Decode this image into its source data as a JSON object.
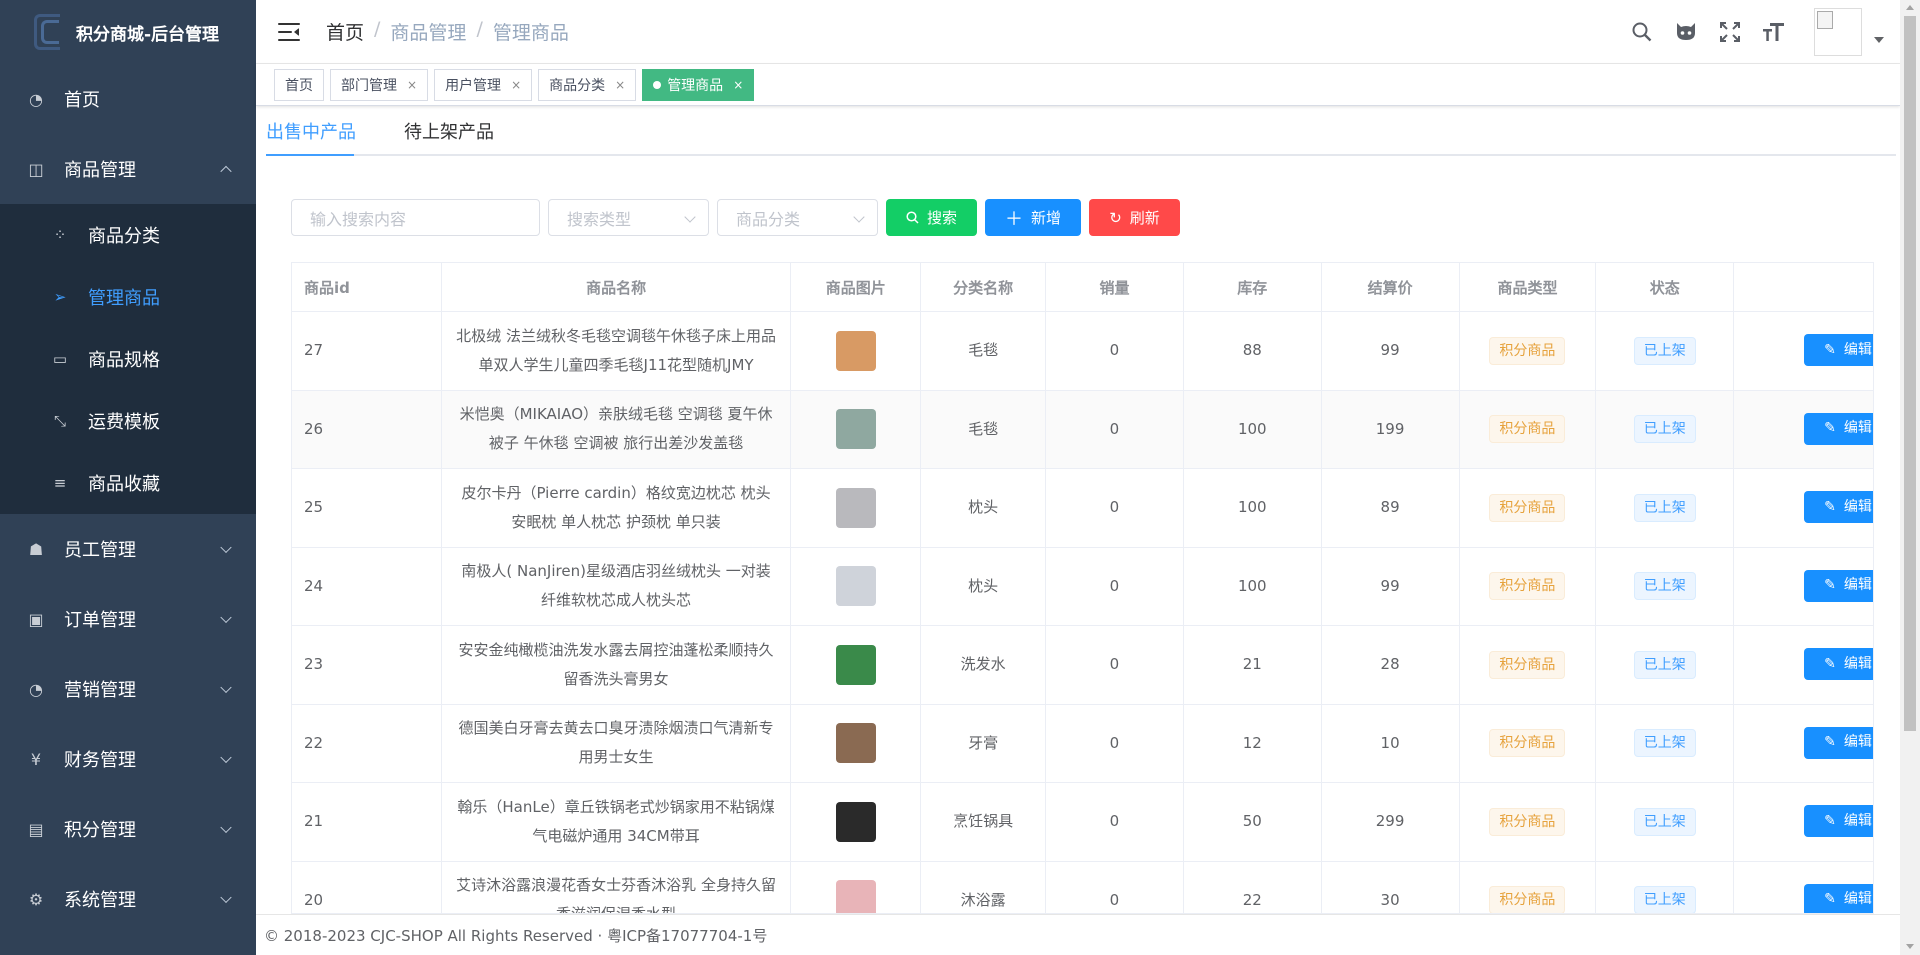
{
  "app": {
    "title": "积分商城-后台管理"
  },
  "sidebar": {
    "items": [
      {
        "label": "首页",
        "icon": "dashboard-icon"
      },
      {
        "label": "商品管理",
        "icon": "shopping-icon",
        "expanded": true,
        "children": [
          {
            "label": "商品分类",
            "icon": "category-icon"
          },
          {
            "label": "管理商品",
            "icon": "send-icon",
            "active": true
          },
          {
            "label": "商品规格",
            "icon": "monitor-icon"
          },
          {
            "label": "运费模板",
            "icon": "shrink-icon"
          },
          {
            "label": "商品收藏",
            "icon": "list-icon"
          }
        ]
      },
      {
        "label": "员工管理",
        "icon": "peoples-icon"
      },
      {
        "label": "订单管理",
        "icon": "lock-icon"
      },
      {
        "label": "营销管理",
        "icon": "dashboard-icon"
      },
      {
        "label": "财务管理",
        "icon": "money-icon"
      },
      {
        "label": "积分管理",
        "icon": "date-icon"
      },
      {
        "label": "系统管理",
        "icon": "gear-icon"
      }
    ]
  },
  "breadcrumb": [
    "首页",
    "商品管理",
    "管理商品"
  ],
  "tags": [
    {
      "label": "首页",
      "closable": false
    },
    {
      "label": "部门管理",
      "closable": true
    },
    {
      "label": "用户管理",
      "closable": true
    },
    {
      "label": "商品分类",
      "closable": true
    },
    {
      "label": "管理商品",
      "closable": true,
      "active": true
    }
  ],
  "tabs": [
    "出售中产品",
    "待上架产品"
  ],
  "toolbar": {
    "search_placeholder": "输入搜索内容",
    "type_placeholder": "搜索类型",
    "category_placeholder": "商品分类",
    "search_label": "搜索",
    "add_label": "新增",
    "refresh_label": "刷新",
    "colors": {
      "search": "#13ce66",
      "add": "#1890ff",
      "refresh": "#ff4949"
    }
  },
  "table": {
    "headers": [
      "商品id",
      "商品名称",
      "商品图片",
      "分类名称",
      "销量",
      "库存",
      "结算价",
      "商品类型",
      "状态"
    ],
    "edit_label": "编辑",
    "rows": [
      {
        "id": "27",
        "name": "北极绒 法兰绒秋冬毛毯空调毯午休毯子床上用品单双人学生儿童四季毛毯J11花型随机JMY",
        "category": "毛毯",
        "sales": "0",
        "stock": "88",
        "price": "99",
        "type": "积分商品",
        "status": "已上架",
        "thumb": "#d89a64"
      },
      {
        "id": "26",
        "name": "米恺奥（MIKAIAO）亲肤绒毛毯 空调毯 夏午休被子 午休毯 空调被 旅行出差沙发盖毯",
        "category": "毛毯",
        "sales": "0",
        "stock": "100",
        "price": "199",
        "type": "积分商品",
        "status": "已上架",
        "thumb": "#8fa8a0"
      },
      {
        "id": "25",
        "name": "皮尔卡丹（Pierre cardin）格纹宽边枕芯 枕头 安眠枕 单人枕芯 护颈枕 单只装",
        "category": "枕头",
        "sales": "0",
        "stock": "100",
        "price": "89",
        "type": "积分商品",
        "status": "已上架",
        "thumb": "#b9b9bd"
      },
      {
        "id": "24",
        "name": "南极人( NanJiren)星级酒店羽丝绒枕头 一对装 纤维软枕芯成人枕头芯",
        "category": "枕头",
        "sales": "0",
        "stock": "100",
        "price": "99",
        "type": "积分商品",
        "status": "已上架",
        "thumb": "#cfd3da"
      },
      {
        "id": "23",
        "name": "安安金纯橄榄油洗发水露去屑控油蓬松柔顺持久留香洗头膏男女",
        "category": "洗发水",
        "sales": "0",
        "stock": "21",
        "price": "28",
        "type": "积分商品",
        "status": "已上架",
        "thumb": "#3a8a4a"
      },
      {
        "id": "22",
        "name": "德国美白牙膏去黄去口臭牙渍除烟渍口气清新专用男士女生",
        "category": "牙膏",
        "sales": "0",
        "stock": "12",
        "price": "10",
        "type": "积分商品",
        "status": "已上架",
        "thumb": "#8a6a52"
      },
      {
        "id": "21",
        "name": "翰乐（HanLe）章丘铁锅老式炒锅家用不粘锅煤气电磁炉通用 34CM带耳",
        "category": "烹饪锅具",
        "sales": "0",
        "stock": "50",
        "price": "299",
        "type": "积分商品",
        "status": "已上架",
        "thumb": "#2a2a2a"
      },
      {
        "id": "20",
        "name": "艾诗沐浴露浪漫花香女士芬香沐浴乳 全身持久留香滋润保湿香水型",
        "category": "沐浴露",
        "sales": "0",
        "stock": "22",
        "price": "30",
        "type": "积分商品",
        "status": "已上架",
        "thumb": "#e8b4b8"
      }
    ]
  },
  "footer": "© 2018-2023 CJC-SHOP All Rights Reserved · 粤ICP备17077704-1号"
}
